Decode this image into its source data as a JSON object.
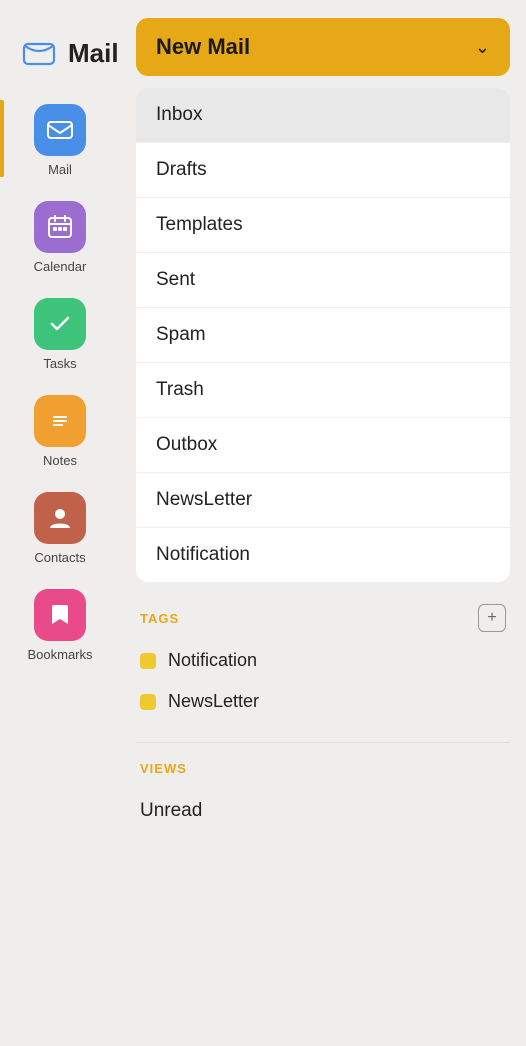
{
  "app": {
    "title": "Mail"
  },
  "sidebar": {
    "items": [
      {
        "id": "mail",
        "label": "Mail",
        "color": "#4a8fe7",
        "active": true
      },
      {
        "id": "calendar",
        "label": "Calendar",
        "color": "#9b6dd0"
      },
      {
        "id": "tasks",
        "label": "Tasks",
        "color": "#3ec47a"
      },
      {
        "id": "notes",
        "label": "Notes",
        "color": "#f0a030"
      },
      {
        "id": "contacts",
        "label": "Contacts",
        "color": "#c0624a"
      },
      {
        "id": "bookmarks",
        "label": "Bookmarks",
        "color": "#e84a8a"
      }
    ]
  },
  "main": {
    "new_mail_label": "New Mail",
    "chevron": "⌄",
    "folders": [
      {
        "label": "Inbox",
        "active": true
      },
      {
        "label": "Drafts",
        "active": false
      },
      {
        "label": "Templates",
        "active": false
      },
      {
        "label": "Sent",
        "active": false
      },
      {
        "label": "Spam",
        "active": false
      },
      {
        "label": "Trash",
        "active": false
      },
      {
        "label": "Outbox",
        "active": false
      },
      {
        "label": "NewsLetter",
        "active": false
      },
      {
        "label": "Notification",
        "active": false
      }
    ],
    "tags_section_title": "TAGS",
    "add_tag_icon": "+",
    "tags": [
      {
        "label": "Notification",
        "color": "#f0c830"
      },
      {
        "label": "NewsLetter",
        "color": "#f0c830"
      }
    ],
    "views_section_title": "VIEWS",
    "views": [
      {
        "label": "Unread"
      }
    ]
  }
}
